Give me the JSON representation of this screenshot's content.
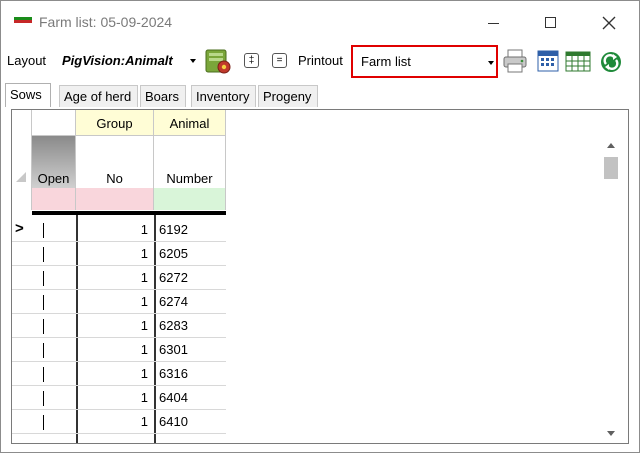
{
  "window": {
    "title": "Farm list: 05-09-2024",
    "minimize_label": "Minimize",
    "maximize_label": "Maximize",
    "close_label": "Close"
  },
  "toolbar": {
    "layout_label": "Layout",
    "layout_value": "PigVision:Animalt",
    "printout_label": "Printout",
    "printout_value": "Farm list",
    "btn_plus_glyph": "‡",
    "btn_equals_glyph": "="
  },
  "tabs": [
    {
      "label": "Sows",
      "active": true
    },
    {
      "label": "Age of herd",
      "active": false
    },
    {
      "label": "Boars",
      "active": false
    },
    {
      "label": "Inventory",
      "active": false
    },
    {
      "label": "Progeny",
      "active": false
    }
  ],
  "grid": {
    "columns": [
      {
        "top": "",
        "bottom": "Open"
      },
      {
        "top": "Group",
        "bottom": "No"
      },
      {
        "top": "Animal",
        "bottom": "Number"
      }
    ],
    "current_row_marker": ">",
    "rows": [
      {
        "group": "1",
        "number": "6192"
      },
      {
        "group": "1",
        "number": "6205"
      },
      {
        "group": "1",
        "number": "6272"
      },
      {
        "group": "1",
        "number": "6274"
      },
      {
        "group": "1",
        "number": "6283"
      },
      {
        "group": "1",
        "number": "6301"
      },
      {
        "group": "1",
        "number": "6316"
      },
      {
        "group": "1",
        "number": "6404"
      },
      {
        "group": "1",
        "number": "6410"
      }
    ]
  },
  "colors": {
    "header_yellow": "#fffdd6",
    "filter_pink": "#f9d6dc",
    "filter_green": "#d9f5d9",
    "highlight_red": "#e00000"
  },
  "icons": {
    "title": "app-flag-icon",
    "layout_settings": "settings-gear-icon",
    "print": "printer-icon",
    "calendar": "calendar-icon",
    "calendar_grid": "calendar-grid-icon",
    "refresh": "refresh-icon"
  }
}
